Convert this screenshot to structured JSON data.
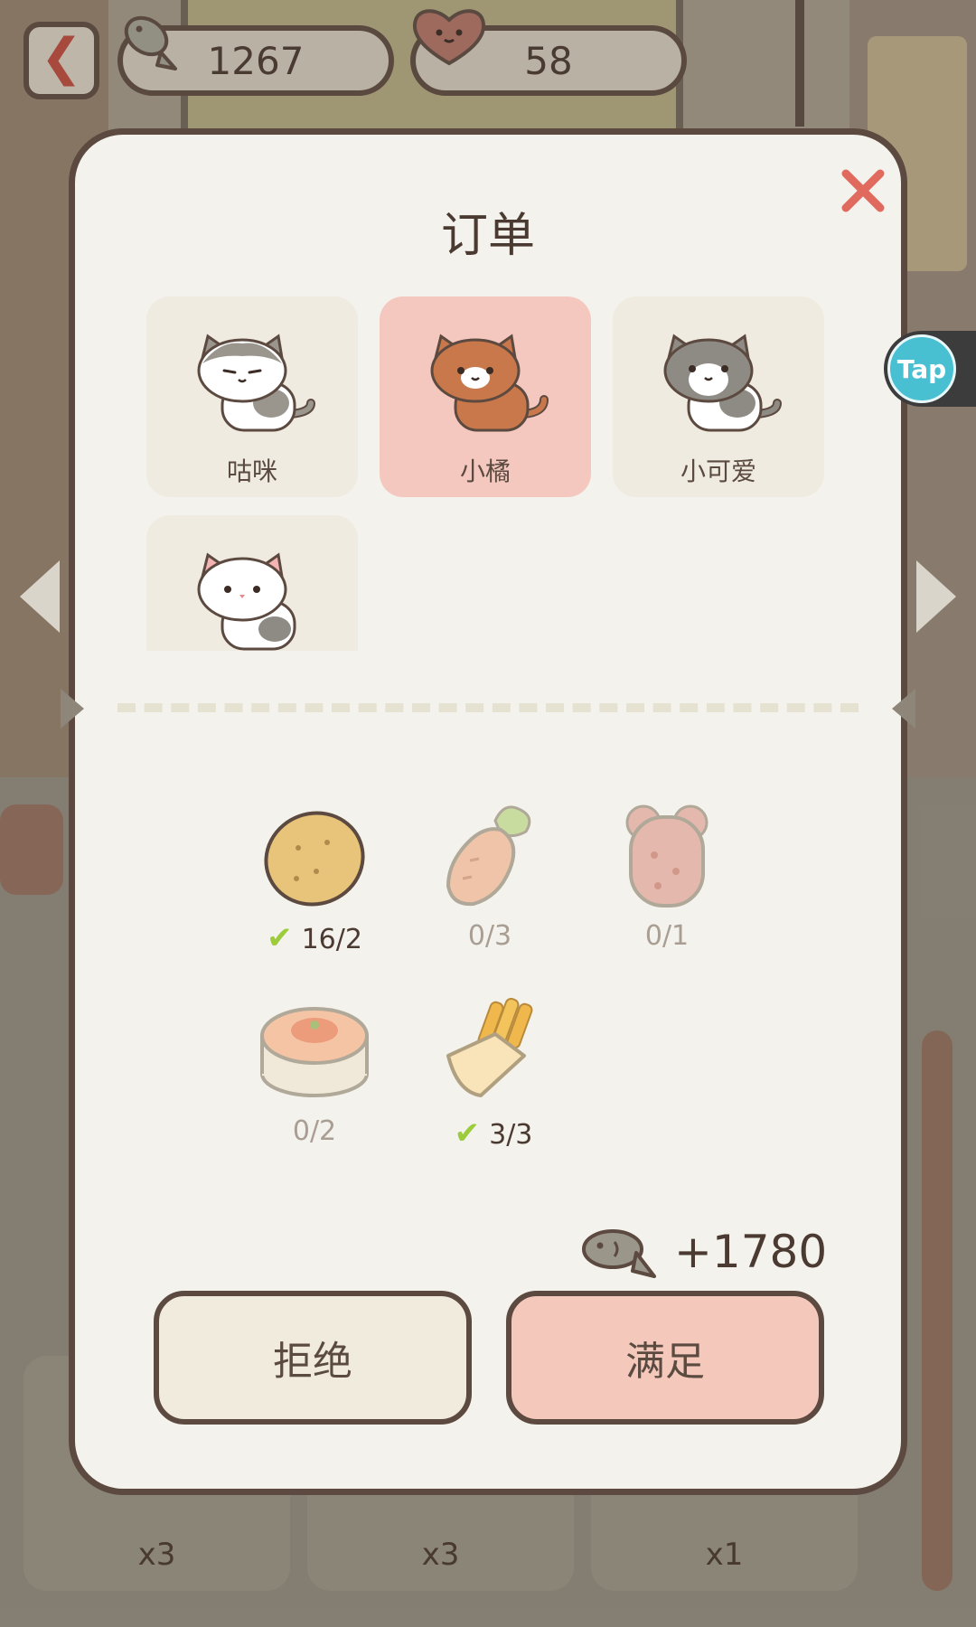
{
  "top_bar": {
    "fish_count": "1267",
    "heart_count": "58"
  },
  "order": {
    "title": "订单",
    "cats": [
      {
        "name": "咕咪",
        "selected": false
      },
      {
        "name": "小橘",
        "selected": true
      },
      {
        "name": "小可爱",
        "selected": false
      },
      {
        "name": "",
        "selected": false
      }
    ],
    "items": [
      {
        "icon": "potato-icon",
        "progress": "16/2",
        "done": true
      },
      {
        "icon": "carrot-icon",
        "progress": "0/3",
        "done": false
      },
      {
        "icon": "bear-gummy-icon",
        "progress": "0/1",
        "done": false
      },
      {
        "icon": "shrimp-dumpling-icon",
        "progress": "0/2",
        "done": false
      },
      {
        "icon": "fries-icon",
        "progress": "3/3",
        "done": true
      }
    ],
    "reward": "+1780",
    "reject_label": "拒绝",
    "accept_label": "满足"
  },
  "floating": {
    "tap_label": "Tap"
  },
  "background": {
    "slot_counts": [
      "x3",
      "x3",
      "x1"
    ]
  },
  "colors": {
    "accent_pink": "#f5c8bc",
    "check_green": "#9ccc3c",
    "outline_brown": "#5c4a40",
    "close_red": "#e06a5e"
  }
}
